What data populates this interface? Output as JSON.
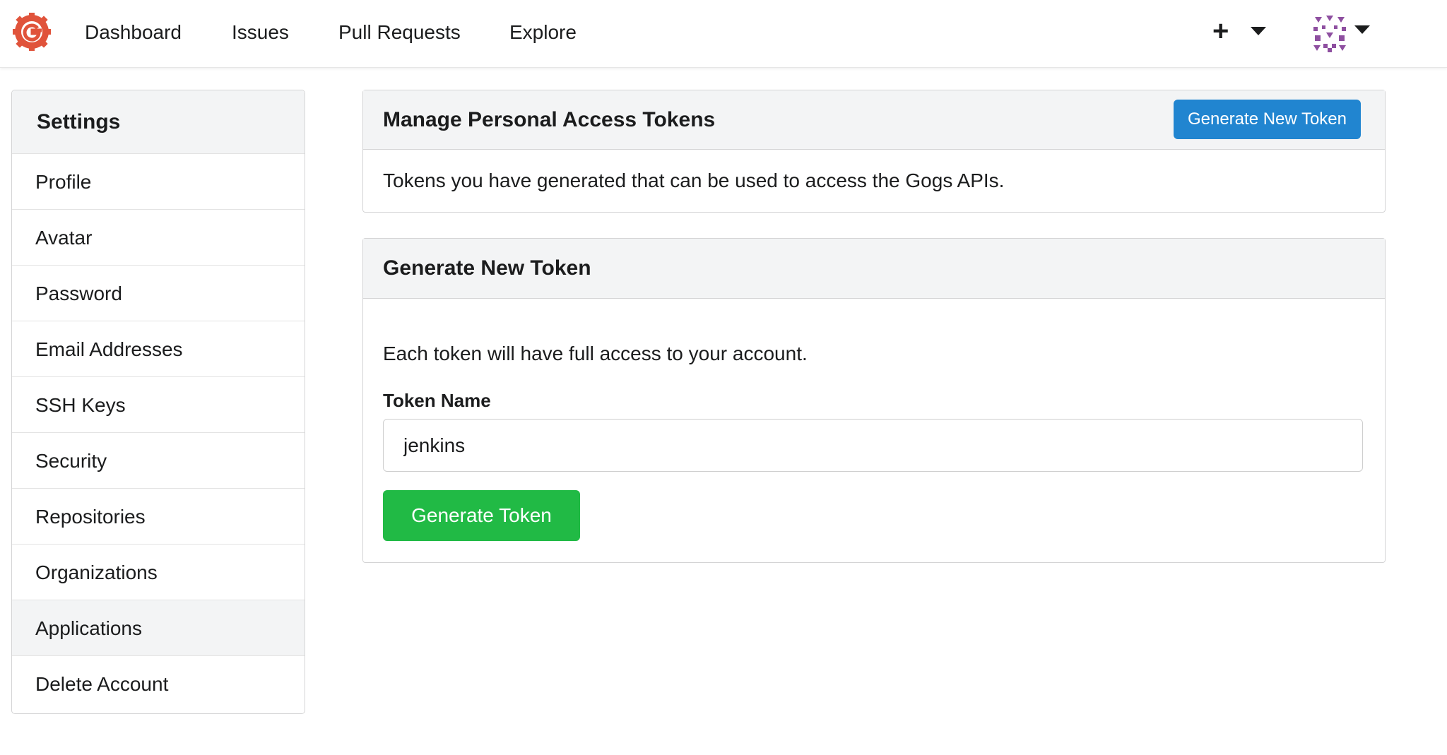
{
  "nav": {
    "links": [
      "Dashboard",
      "Issues",
      "Pull Requests",
      "Explore"
    ],
    "logo_icon": "gogs-logo-icon",
    "create_icon": "plus-icon",
    "avatar_icon": "identicon-avatar"
  },
  "sidebar": {
    "title": "Settings",
    "items": [
      {
        "label": "Profile"
      },
      {
        "label": "Avatar"
      },
      {
        "label": "Password"
      },
      {
        "label": "Email Addresses"
      },
      {
        "label": "SSH Keys"
      },
      {
        "label": "Security"
      },
      {
        "label": "Repositories"
      },
      {
        "label": "Organizations"
      },
      {
        "label": "Applications",
        "active": true
      },
      {
        "label": "Delete Account"
      }
    ]
  },
  "manage_panel": {
    "title": "Manage Personal Access Tokens",
    "button_label": "Generate New Token",
    "description": "Tokens you have generated that can be used to access the Gogs APIs."
  },
  "generate_panel": {
    "title": "Generate New Token",
    "description": "Each token will have full access to your account.",
    "field_label": "Token Name",
    "field_value": "jenkins",
    "submit_label": "Generate Token"
  },
  "colors": {
    "primary_button": "#2185d0",
    "submit_button": "#21ba45",
    "logo": "#e0533b",
    "avatar": "#8e4fa0"
  }
}
